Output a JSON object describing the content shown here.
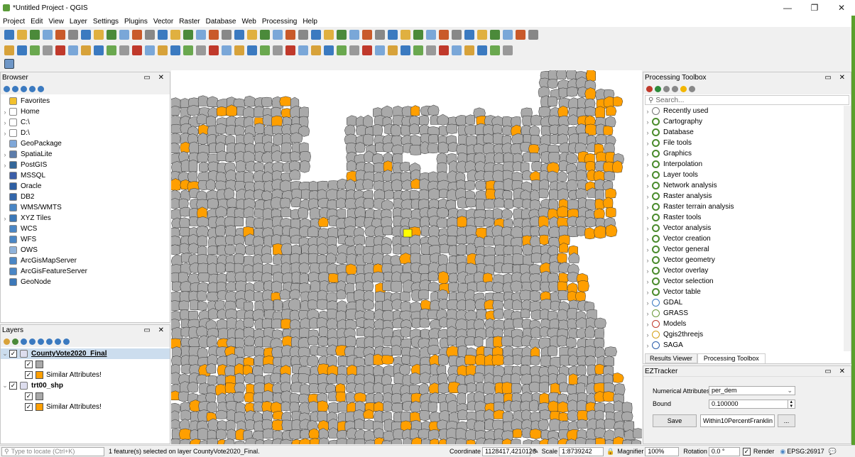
{
  "window": {
    "title": "*Untitled Project - QGIS",
    "minimize": "—",
    "maximize": "❐",
    "close": "✕"
  },
  "menu": [
    "Project",
    "Edit",
    "View",
    "Layer",
    "Settings",
    "Plugins",
    "Vector",
    "Raster",
    "Database",
    "Web",
    "Processing",
    "Help"
  ],
  "browser": {
    "title": "Browser",
    "search_placeholder": "",
    "items": [
      {
        "label": "Favorites",
        "icon": "star-icon",
        "color": "#f2c12e",
        "expand": false
      },
      {
        "label": "Home",
        "icon": "home-icon",
        "color": "#ffffff",
        "expand": true
      },
      {
        "label": "C:\\",
        "icon": "folder-icon",
        "color": "#ffffff",
        "expand": true
      },
      {
        "label": "D:\\",
        "icon": "folder-icon",
        "color": "#ffffff",
        "expand": true
      },
      {
        "label": "GeoPackage",
        "icon": "geopackage-icon",
        "color": "#7fa7d8",
        "expand": false
      },
      {
        "label": "SpatiaLite",
        "icon": "feather-icon",
        "color": "#5c7caa",
        "expand": true
      },
      {
        "label": "PostGIS",
        "icon": "elephant-icon",
        "color": "#336699",
        "expand": true
      },
      {
        "label": "MSSQL",
        "icon": "mssql-icon",
        "color": "#3b5ea8",
        "expand": false
      },
      {
        "label": "Oracle",
        "icon": "oracle-icon",
        "color": "#2e5fa3",
        "expand": false
      },
      {
        "label": "DB2",
        "icon": "db2-icon",
        "color": "#3366aa",
        "expand": false
      },
      {
        "label": "WMS/WMTS",
        "icon": "globe-icon",
        "color": "#4a86c5",
        "expand": false
      },
      {
        "label": "XYZ Tiles",
        "icon": "xyz-icon",
        "color": "#3c78b8",
        "expand": true
      },
      {
        "label": "WCS",
        "icon": "globe-icon",
        "color": "#4a86c5",
        "expand": false
      },
      {
        "label": "WFS",
        "icon": "globe-icon",
        "color": "#4a86c5",
        "expand": false
      },
      {
        "label": "OWS",
        "icon": "globe-icon",
        "color": "#8fb2da",
        "expand": false
      },
      {
        "label": "ArcGisMapServer",
        "icon": "arcgis-icon",
        "color": "#4a86c5",
        "expand": false
      },
      {
        "label": "ArcGisFeatureServer",
        "icon": "arcgis-icon",
        "color": "#4a86c5",
        "expand": false
      },
      {
        "label": "GeoNode",
        "icon": "geonode-icon",
        "color": "#3c78b8",
        "expand": false
      }
    ]
  },
  "layers": {
    "title": "Layers",
    "entries": [
      {
        "label": "CountyVote2020_Final",
        "kind": "layer",
        "bold": true,
        "underline": true,
        "selected": true
      },
      {
        "label": "",
        "kind": "symbol",
        "color": "#a9a9a9"
      },
      {
        "label": "Similar Attributes!",
        "kind": "symbol",
        "color": "#ff9f00"
      },
      {
        "label": "trt00_shp",
        "kind": "layer",
        "bold": true,
        "underline": false,
        "selected": false
      },
      {
        "label": "",
        "kind": "symbol",
        "color": "#a9a9a9"
      },
      {
        "label": "Similar Attributes!",
        "kind": "symbol",
        "color": "#ff9f00"
      }
    ]
  },
  "toolbox": {
    "title": "Processing Toolbox",
    "search_placeholder": "Search...",
    "items": [
      {
        "label": "Recently used",
        "icon": "clock-icon"
      },
      {
        "label": "Cartography",
        "icon": "qgis-icon"
      },
      {
        "label": "Database",
        "icon": "qgis-icon"
      },
      {
        "label": "File tools",
        "icon": "qgis-icon"
      },
      {
        "label": "Graphics",
        "icon": "qgis-icon"
      },
      {
        "label": "Interpolation",
        "icon": "qgis-icon"
      },
      {
        "label": "Layer tools",
        "icon": "qgis-icon"
      },
      {
        "label": "Network analysis",
        "icon": "qgis-icon"
      },
      {
        "label": "Raster analysis",
        "icon": "qgis-icon"
      },
      {
        "label": "Raster terrain analysis",
        "icon": "qgis-icon"
      },
      {
        "label": "Raster tools",
        "icon": "qgis-icon"
      },
      {
        "label": "Vector analysis",
        "icon": "qgis-icon"
      },
      {
        "label": "Vector creation",
        "icon": "qgis-icon"
      },
      {
        "label": "Vector general",
        "icon": "qgis-icon"
      },
      {
        "label": "Vector geometry",
        "icon": "qgis-icon"
      },
      {
        "label": "Vector overlay",
        "icon": "qgis-icon"
      },
      {
        "label": "Vector selection",
        "icon": "qgis-icon"
      },
      {
        "label": "Vector table",
        "icon": "qgis-icon"
      },
      {
        "label": "GDAL",
        "icon": "gdal-icon"
      },
      {
        "label": "GRASS",
        "icon": "grass-icon"
      },
      {
        "label": "Models",
        "icon": "models-icon"
      },
      {
        "label": "Qgis2threejs",
        "icon": "threejs-icon"
      },
      {
        "label": "SAGA",
        "icon": "saga-icon"
      }
    ],
    "tabs": [
      "Results Viewer",
      "Processing Toolbox"
    ]
  },
  "ez": {
    "title": "EZTracker",
    "num_label": "Numerical Attributes",
    "num_value": "per_dem",
    "bound_label": "Bound",
    "bound_value": "0.100000",
    "save_label": "Save",
    "name_value": "Within10PercentFranklin",
    "more_label": "..."
  },
  "status": {
    "locate_placeholder": "Type to locate (Ctrl+K)",
    "message": "1 feature(s) selected on layer CountyVote2020_Final.",
    "coord_label": "Coordinate",
    "coord_value": "1128417,4210126",
    "scale_label": "Scale",
    "scale_value": "1:8739242",
    "magnifier_label": "Magnifier",
    "magnifier_value": "100%",
    "rotation_label": "Rotation",
    "rotation_value": "0.0 °",
    "render_label": "Render",
    "crs": "EPSG:26917"
  },
  "colors": {
    "county": "#a9a9a9",
    "similar": "#ff9f00",
    "selected": "#ffff00",
    "water": "#ffffff",
    "county_border": "#333333"
  }
}
